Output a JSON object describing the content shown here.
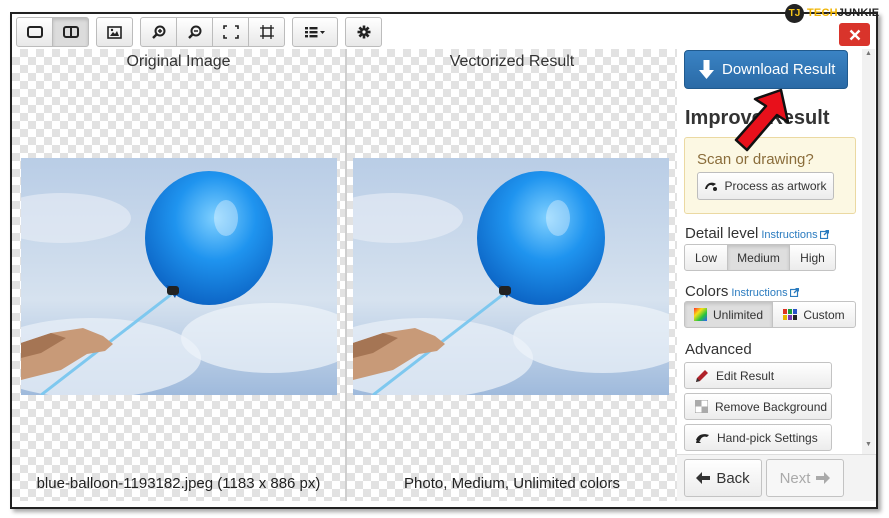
{
  "brand": {
    "logo": "TJ",
    "name_part1": "TECH",
    "name_part2": "JUNKIE"
  },
  "toolbar": {
    "buttons": [
      {
        "icon": "single-view-icon",
        "active": false
      },
      {
        "icon": "split-view-icon",
        "active": true
      },
      {
        "icon": "image-icon",
        "active": false
      },
      {
        "icon": "zoom-in-icon",
        "active": false
      },
      {
        "icon": "zoom-out-icon",
        "active": false
      },
      {
        "icon": "fit-frame-icon",
        "active": false
      },
      {
        "icon": "actual-size-icon",
        "active": false
      },
      {
        "icon": "list-menu-icon",
        "active": false
      },
      {
        "icon": "gear-icon",
        "active": false
      }
    ],
    "close_icon": "close-icon"
  },
  "panes": {
    "left": {
      "title": "Original Image",
      "caption": "blue-balloon-1193182.jpeg (1183 x 886 px)"
    },
    "right": {
      "title": "Vectorized Result",
      "caption": "Photo, Medium, Unlimited colors"
    }
  },
  "sidebar": {
    "download_label": "Download Result",
    "improve_heading": "Improve Result",
    "scan": {
      "title": "Scan or drawing?",
      "button_label": "Process as artwork"
    },
    "detail": {
      "label": "Detail level",
      "instructions": "Instructions",
      "options": [
        "Low",
        "Medium",
        "High"
      ],
      "selected": "Medium"
    },
    "colors": {
      "label": "Colors",
      "instructions": "Instructions",
      "options": [
        "Unlimited",
        "Custom"
      ],
      "selected": "Unlimited"
    },
    "advanced": {
      "label": "Advanced",
      "buttons": [
        "Edit Result",
        "Remove Background",
        "Hand-pick Settings"
      ]
    },
    "nav": {
      "back_label": "Back",
      "next_label": "Next"
    }
  },
  "colors": {
    "primary": "#2f74b5",
    "danger": "#d9342b",
    "annotation_arrow": "#e8101b",
    "warning_bg": "#fcf8e3",
    "brand_yellow": "#f0b400"
  }
}
